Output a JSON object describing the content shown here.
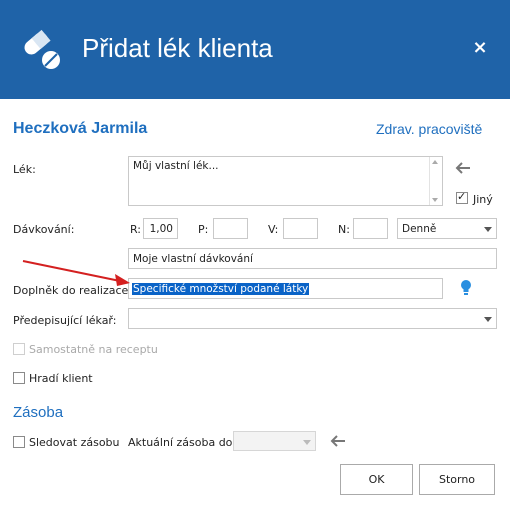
{
  "dialog": {
    "title": "Přidat lék klienta",
    "close_label": "×"
  },
  "header": {
    "patient_name": "Heczková Jarmila",
    "workplace_link": "Zdrav. pracoviště"
  },
  "medication": {
    "label": "Lék:",
    "value": "Můj vlastní lék...",
    "other_label": "Jiný",
    "other_checked": true
  },
  "dosage": {
    "label": "Dávkování:",
    "r_label": "R:",
    "r_value": "1,00",
    "p_label": "P:",
    "p_value": "",
    "v_label": "V:",
    "v_value": "",
    "n_label": "N:",
    "n_value": "",
    "frequency": "Denně",
    "custom_value": "Moje vlastní dávkování"
  },
  "supplement": {
    "label": "Doplněk do realizace:",
    "value": "Specifické množství podané látky"
  },
  "prescriber": {
    "label": "Předepisující lékař:",
    "value": ""
  },
  "checkboxes": {
    "separately_label": "Samostatně na receptu",
    "client_pays_label": "Hradí klient"
  },
  "stock": {
    "heading": "Zásoba",
    "track_label": "Sledovat zásobu",
    "current_label": "Aktuální zásoba do:",
    "current_value": ""
  },
  "buttons": {
    "ok": "OK",
    "cancel": "Storno"
  },
  "colors": {
    "titlebar": "#1f63a8",
    "accent": "#1f6fbf",
    "selection": "#0a63c7",
    "annotation_arrow": "#d42020"
  }
}
